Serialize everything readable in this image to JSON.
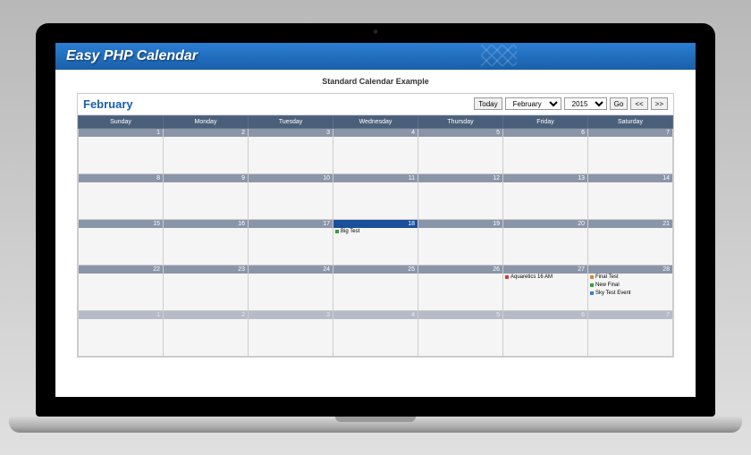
{
  "header": {
    "app_title": "Easy PHP Calendar"
  },
  "example": {
    "title": "Standard Calendar Example"
  },
  "calendar": {
    "month": "February",
    "controls": {
      "today": "Today",
      "month_select": "February",
      "year_select": "2015",
      "go": "Go",
      "prev": "<<",
      "next": ">>"
    },
    "days": [
      "Sunday",
      "Monday",
      "Tuesday",
      "Wednesday",
      "Thursday",
      "Friday",
      "Saturday"
    ],
    "weeks": [
      [
        {
          "num": "1"
        },
        {
          "num": "2"
        },
        {
          "num": "3"
        },
        {
          "num": "4"
        },
        {
          "num": "5"
        },
        {
          "num": "6"
        },
        {
          "num": "7"
        }
      ],
      [
        {
          "num": "8"
        },
        {
          "num": "9"
        },
        {
          "num": "10"
        },
        {
          "num": "11"
        },
        {
          "num": "12"
        },
        {
          "num": "13"
        },
        {
          "num": "14"
        }
      ],
      [
        {
          "num": "15"
        },
        {
          "num": "16"
        },
        {
          "num": "17"
        },
        {
          "num": "18",
          "today": true,
          "events": [
            {
              "color": "green",
              "text": "Big Test"
            }
          ]
        },
        {
          "num": "19"
        },
        {
          "num": "20"
        },
        {
          "num": "21"
        }
      ],
      [
        {
          "num": "22"
        },
        {
          "num": "23"
        },
        {
          "num": "24"
        },
        {
          "num": "25"
        },
        {
          "num": "26"
        },
        {
          "num": "27",
          "events": [
            {
              "color": "red",
              "text": "Aquaretics 16 AM"
            }
          ]
        },
        {
          "num": "28",
          "events": [
            {
              "color": "orange",
              "text": "Final Test"
            },
            {
              "color": "green",
              "text": "New Final"
            },
            {
              "color": "blue",
              "text": "Sky Test Event"
            }
          ]
        }
      ],
      [
        {
          "num": "1",
          "other": true
        },
        {
          "num": "2",
          "other": true
        },
        {
          "num": "3",
          "other": true
        },
        {
          "num": "4",
          "other": true
        },
        {
          "num": "5",
          "other": true
        },
        {
          "num": "6",
          "other": true
        },
        {
          "num": "7",
          "other": true
        }
      ]
    ]
  }
}
